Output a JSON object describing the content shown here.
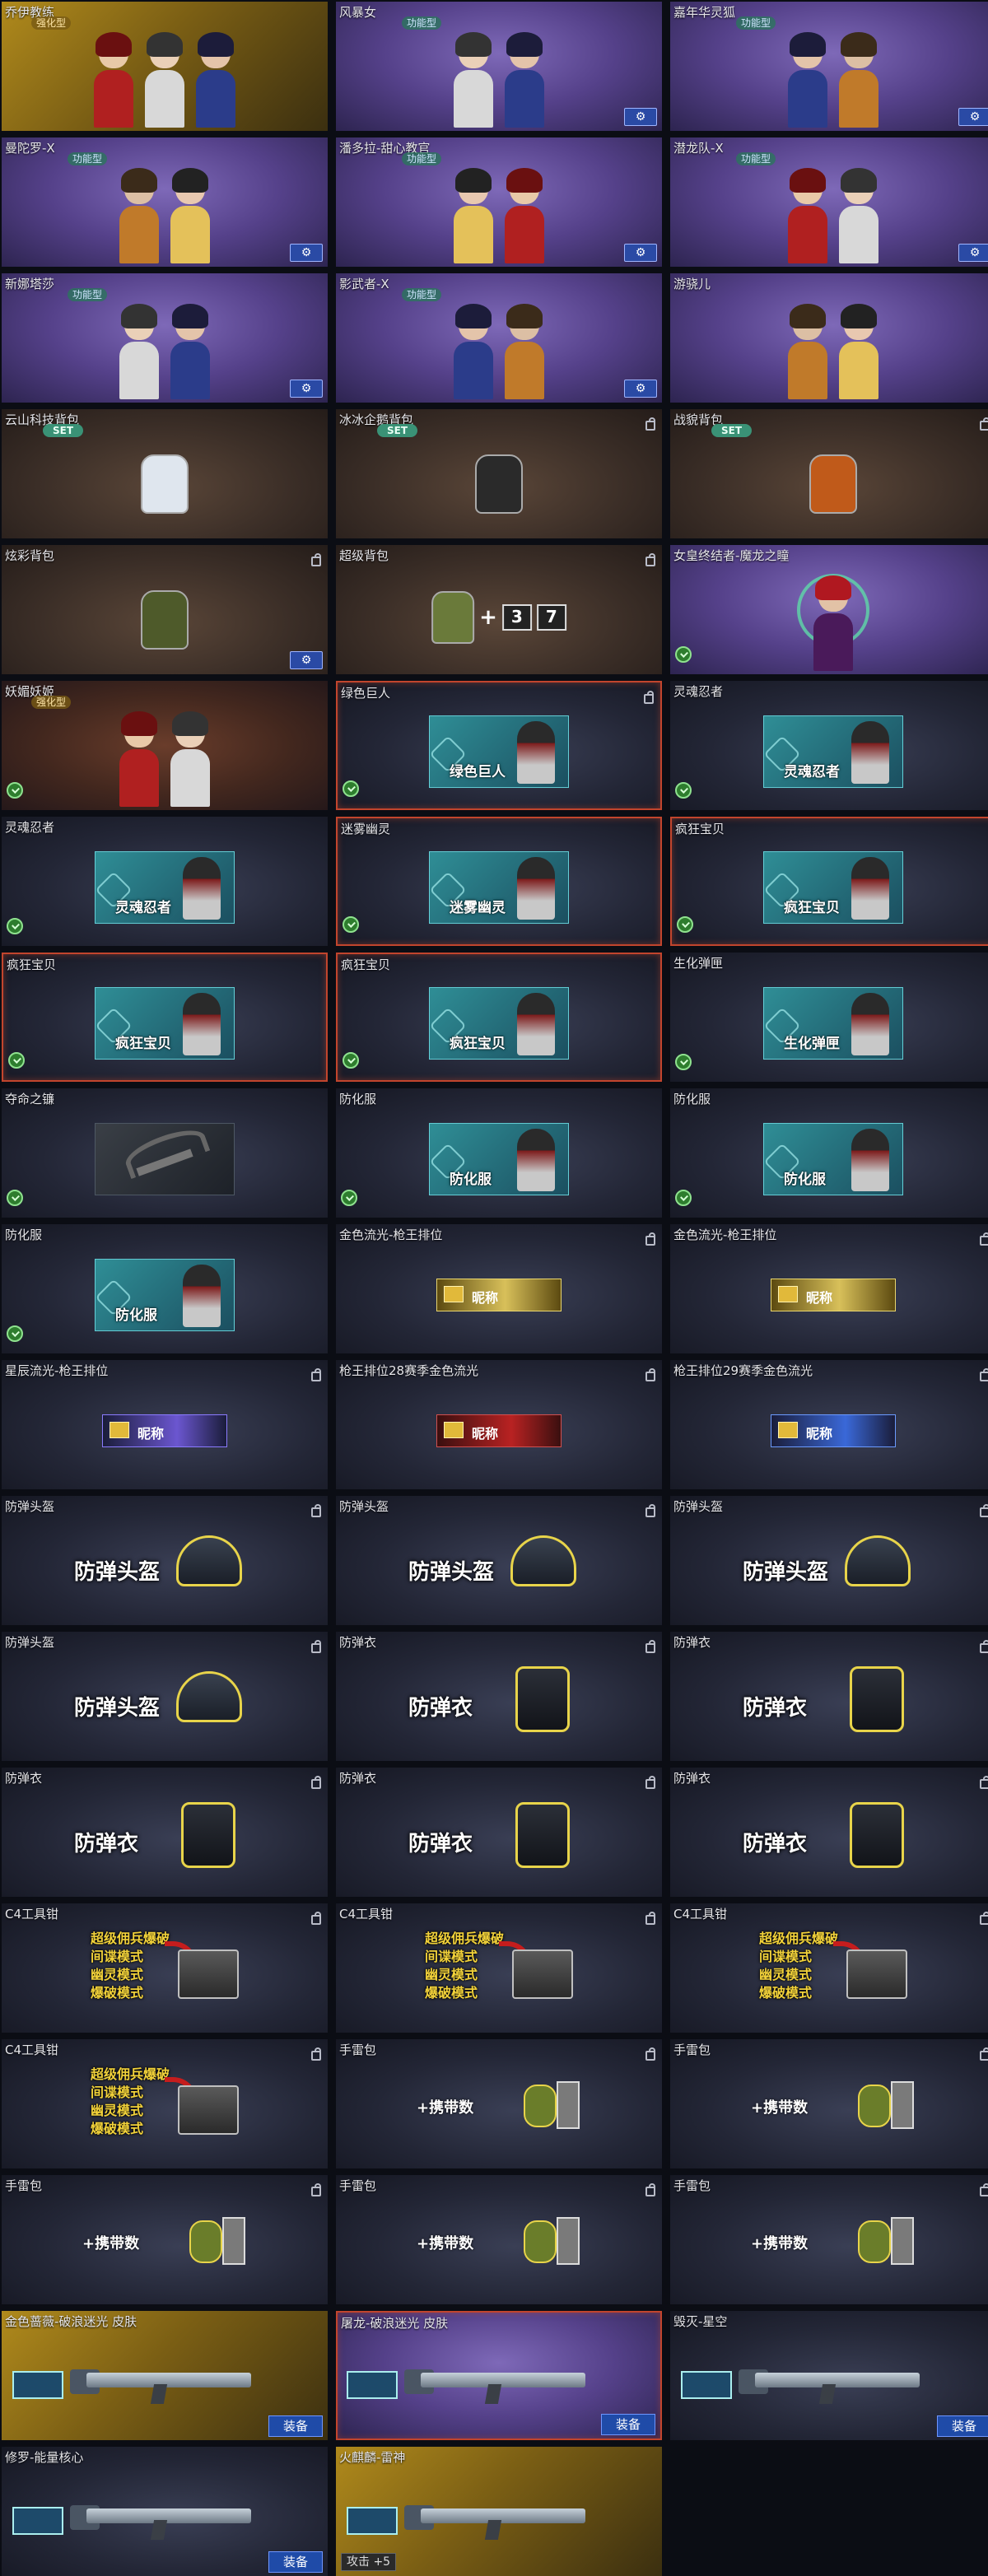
{
  "colors": {
    "background": "#0b0d14",
    "selected_border": "#c2452d",
    "equip_button": "#1f4ba8",
    "set_badge": "#3a9276",
    "gold_highlight": "#e9d66f"
  },
  "cells": [
    {
      "title": "乔伊教练",
      "badge": "强化型",
      "style": "gold",
      "kind": "chars",
      "figures": 3
    },
    {
      "title": "风暴女",
      "badge": "功能型",
      "style": "purple",
      "kind": "chars",
      "figures": 2,
      "gear": true
    },
    {
      "title": "嘉年华灵狐",
      "badge": "功能型",
      "style": "purple",
      "kind": "chars",
      "figures": 2,
      "gear": true
    },
    {
      "title": "曼陀罗-X",
      "badge": "功能型",
      "style": "purple",
      "kind": "chars",
      "figures": 2,
      "gear": true
    },
    {
      "title": "潘多拉-甜心教官",
      "badge": "功能型",
      "style": "purple",
      "kind": "chars",
      "figures": 2,
      "gear": true
    },
    {
      "title": "潜龙队-X",
      "badge": "功能型",
      "style": "purple",
      "kind": "chars",
      "figures": 2,
      "gear": true
    },
    {
      "title": "新娜塔莎",
      "badge": "功能型",
      "style": "purple",
      "kind": "chars",
      "figures": 2,
      "gear": true
    },
    {
      "title": "影武者-X",
      "badge": "功能型",
      "style": "purple",
      "kind": "chars",
      "figures": 2,
      "gear": true
    },
    {
      "title": "游骁儿",
      "style": "purple",
      "kind": "chars",
      "figures": 2
    },
    {
      "title": "云山科技背包",
      "badge": "SET",
      "style": "brown",
      "kind": "pack",
      "packColor": "#dfe6ee"
    },
    {
      "title": "冰冰企鹅背包",
      "badge": "SET",
      "style": "brown",
      "kind": "pack",
      "packColor": "#2a2a2a",
      "lock": true
    },
    {
      "title": "战貌背包",
      "badge": "SET",
      "style": "brown",
      "kind": "pack",
      "packColor": "#c05a1a",
      "lock": true
    },
    {
      "title": "炫彩背包",
      "style": "brown",
      "kind": "pack",
      "packColor": "#4e5a2a",
      "lock": true
    },
    {
      "title": "超级背包",
      "style": "brown",
      "kind": "packplus",
      "packColor": "#6a7a3a",
      "lock": true,
      "nums": [
        "3",
        "7"
      ]
    },
    {
      "title": "女皇终结者-魔龙之瞳",
      "style": "purple",
      "kind": "emblem",
      "green": true
    },
    {
      "title": "妖媚妖姬",
      "badge": "强化型",
      "style": "rust",
      "kind": "chars",
      "figures": 2,
      "green": true
    },
    {
      "title": "绿色巨人",
      "style": "dark",
      "kind": "card",
      "card": "绿色巨人",
      "green": true,
      "lock": true,
      "selected": true
    },
    {
      "title": "灵魂忍者",
      "style": "dark",
      "kind": "card",
      "card": "灵魂忍者",
      "green": true
    },
    {
      "title": "灵魂忍者",
      "style": "dark",
      "kind": "card",
      "card": "灵魂忍者",
      "green": true
    },
    {
      "title": "迷雾幽灵",
      "style": "dark",
      "kind": "card",
      "card": "迷雾幽灵",
      "green": true,
      "selected": true
    },
    {
      "title": "疯狂宝贝",
      "style": "dark",
      "kind": "card",
      "card": "疯狂宝贝",
      "green": true,
      "selected": true
    },
    {
      "title": "疯狂宝贝",
      "style": "dark",
      "kind": "card",
      "card": "疯狂宝贝",
      "green": true,
      "selected": true
    },
    {
      "title": "疯狂宝贝",
      "style": "dark",
      "kind": "card",
      "card": "疯狂宝贝",
      "green": true,
      "selected": true
    },
    {
      "title": "生化弹匣",
      "style": "dark",
      "kind": "card",
      "card": "生化弹匣",
      "green": true
    },
    {
      "title": "夺命之镰",
      "style": "dark",
      "kind": "scythe",
      "green": true
    },
    {
      "title": "防化服",
      "style": "dark",
      "kind": "card",
      "card": "防化服",
      "green": true
    },
    {
      "title": "防化服",
      "style": "dark",
      "kind": "card",
      "card": "防化服",
      "green": true
    },
    {
      "title": "防化服",
      "style": "dark",
      "kind": "card",
      "card": "防化服",
      "green": true
    },
    {
      "title": "金色流光-枪王排位",
      "style": "dark",
      "kind": "plate",
      "plate": "gold",
      "name": "昵称",
      "lock": true
    },
    {
      "title": "金色流光-枪王排位",
      "style": "dark",
      "kind": "plate",
      "plate": "gold",
      "name": "昵称",
      "lock": true
    },
    {
      "title": "星辰流光-枪王排位",
      "style": "dark",
      "kind": "plate",
      "plate": "star",
      "name": "昵称",
      "lock": true
    },
    {
      "title": "枪王排位28赛季金色流光",
      "style": "dark",
      "kind": "plate",
      "plate": "red",
      "name": "昵称",
      "lock": true
    },
    {
      "title": "枪王排位29赛季金色流光",
      "style": "dark",
      "kind": "plate",
      "plate": "blue",
      "name": "昵称",
      "lock": true
    },
    {
      "title": "防弹头盔",
      "style": "dark",
      "kind": "helmet",
      "label": "防弹头盔",
      "lock": true
    },
    {
      "title": "防弹头盔",
      "style": "dark",
      "kind": "helmet",
      "label": "防弹头盔",
      "lock": true
    },
    {
      "title": "防弹头盔",
      "style": "dark",
      "kind": "helmet",
      "label": "防弹头盔",
      "lock": true
    },
    {
      "title": "防弹头盔",
      "style": "dark",
      "kind": "helmet",
      "label": "防弹头盔",
      "lock": true
    },
    {
      "title": "防弹衣",
      "style": "dark",
      "kind": "vest",
      "label": "防弹衣",
      "lock": true
    },
    {
      "title": "防弹衣",
      "style": "dark",
      "kind": "vest",
      "label": "防弹衣",
      "lock": true
    },
    {
      "title": "防弹衣",
      "style": "dark",
      "kind": "vest",
      "label": "防弹衣",
      "lock": true
    },
    {
      "title": "防弹衣",
      "style": "dark",
      "kind": "vest",
      "label": "防弹衣",
      "lock": true
    },
    {
      "title": "防弹衣",
      "style": "dark",
      "kind": "vest",
      "label": "防弹衣",
      "lock": true
    },
    {
      "title": "C4工具钳",
      "style": "dark",
      "kind": "c4",
      "lines": [
        "超级佣兵爆破",
        "间谍模式",
        "幽灵模式",
        "爆破模式"
      ],
      "lock": true
    },
    {
      "title": "C4工具钳",
      "style": "dark",
      "kind": "c4",
      "lines": [
        "超级佣兵爆破",
        "间谍模式",
        "幽灵模式",
        "爆破模式"
      ],
      "lock": true
    },
    {
      "title": "C4工具钳",
      "style": "dark",
      "kind": "c4",
      "lines": [
        "超级佣兵爆破",
        "间谍模式",
        "幽灵模式",
        "爆破模式"
      ],
      "lock": true
    },
    {
      "title": "C4工具钳",
      "style": "dark",
      "kind": "c4",
      "lines": [
        "超级佣兵爆破",
        "间谍模式",
        "幽灵模式",
        "爆破模式"
      ],
      "lock": true
    },
    {
      "title": "手雷包",
      "style": "dark",
      "kind": "grenade",
      "label": "+携带数",
      "lock": true
    },
    {
      "title": "手雷包",
      "style": "dark",
      "kind": "grenade",
      "label": "+携带数",
      "lock": true
    },
    {
      "title": "手雷包",
      "style": "dark",
      "kind": "grenade",
      "label": "+携带数",
      "lock": true
    },
    {
      "title": "手雷包",
      "style": "dark",
      "kind": "grenade",
      "label": "+携带数",
      "lock": true
    },
    {
      "title": "手雷包",
      "style": "dark",
      "kind": "grenade",
      "label": "+携带数",
      "lock": true
    },
    {
      "title": "金色蔷薇-破浪迷光 皮肤",
      "style": "gold",
      "kind": "gun",
      "equip": "装备"
    },
    {
      "title": "屠龙-破浪迷光 皮肤",
      "style": "purple",
      "kind": "gun",
      "equip": "装备",
      "selected": true
    },
    {
      "title": "毁灭-星空",
      "style": "dark",
      "kind": "gun",
      "equip": "装备"
    },
    {
      "title": "修罗-能量核心",
      "style": "dark",
      "kind": "gun",
      "equip": "装备"
    },
    {
      "title": "火麒麟-雷神",
      "style": "gold",
      "kind": "gun",
      "stat": "攻击 +5"
    }
  ]
}
